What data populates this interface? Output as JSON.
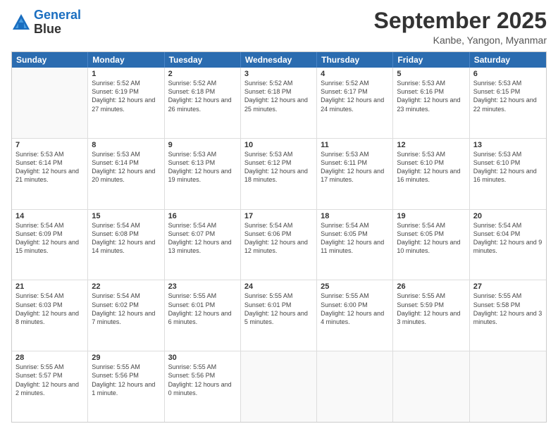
{
  "logo": {
    "line1": "General",
    "line2": "Blue"
  },
  "title": "September 2025",
  "location": "Kanbe, Yangon, Myanmar",
  "weekdays": [
    "Sunday",
    "Monday",
    "Tuesday",
    "Wednesday",
    "Thursday",
    "Friday",
    "Saturday"
  ],
  "rows": [
    [
      {
        "day": "",
        "sunrise": "",
        "sunset": "",
        "daylight": ""
      },
      {
        "day": "1",
        "sunrise": "Sunrise: 5:52 AM",
        "sunset": "Sunset: 6:19 PM",
        "daylight": "Daylight: 12 hours and 27 minutes."
      },
      {
        "day": "2",
        "sunrise": "Sunrise: 5:52 AM",
        "sunset": "Sunset: 6:18 PM",
        "daylight": "Daylight: 12 hours and 26 minutes."
      },
      {
        "day": "3",
        "sunrise": "Sunrise: 5:52 AM",
        "sunset": "Sunset: 6:18 PM",
        "daylight": "Daylight: 12 hours and 25 minutes."
      },
      {
        "day": "4",
        "sunrise": "Sunrise: 5:52 AM",
        "sunset": "Sunset: 6:17 PM",
        "daylight": "Daylight: 12 hours and 24 minutes."
      },
      {
        "day": "5",
        "sunrise": "Sunrise: 5:53 AM",
        "sunset": "Sunset: 6:16 PM",
        "daylight": "Daylight: 12 hours and 23 minutes."
      },
      {
        "day": "6",
        "sunrise": "Sunrise: 5:53 AM",
        "sunset": "Sunset: 6:15 PM",
        "daylight": "Daylight: 12 hours and 22 minutes."
      }
    ],
    [
      {
        "day": "7",
        "sunrise": "Sunrise: 5:53 AM",
        "sunset": "Sunset: 6:14 PM",
        "daylight": "Daylight: 12 hours and 21 minutes."
      },
      {
        "day": "8",
        "sunrise": "Sunrise: 5:53 AM",
        "sunset": "Sunset: 6:14 PM",
        "daylight": "Daylight: 12 hours and 20 minutes."
      },
      {
        "day": "9",
        "sunrise": "Sunrise: 5:53 AM",
        "sunset": "Sunset: 6:13 PM",
        "daylight": "Daylight: 12 hours and 19 minutes."
      },
      {
        "day": "10",
        "sunrise": "Sunrise: 5:53 AM",
        "sunset": "Sunset: 6:12 PM",
        "daylight": "Daylight: 12 hours and 18 minutes."
      },
      {
        "day": "11",
        "sunrise": "Sunrise: 5:53 AM",
        "sunset": "Sunset: 6:11 PM",
        "daylight": "Daylight: 12 hours and 17 minutes."
      },
      {
        "day": "12",
        "sunrise": "Sunrise: 5:53 AM",
        "sunset": "Sunset: 6:10 PM",
        "daylight": "Daylight: 12 hours and 16 minutes."
      },
      {
        "day": "13",
        "sunrise": "Sunrise: 5:53 AM",
        "sunset": "Sunset: 6:10 PM",
        "daylight": "Daylight: 12 hours and 16 minutes."
      }
    ],
    [
      {
        "day": "14",
        "sunrise": "Sunrise: 5:54 AM",
        "sunset": "Sunset: 6:09 PM",
        "daylight": "Daylight: 12 hours and 15 minutes."
      },
      {
        "day": "15",
        "sunrise": "Sunrise: 5:54 AM",
        "sunset": "Sunset: 6:08 PM",
        "daylight": "Daylight: 12 hours and 14 minutes."
      },
      {
        "day": "16",
        "sunrise": "Sunrise: 5:54 AM",
        "sunset": "Sunset: 6:07 PM",
        "daylight": "Daylight: 12 hours and 13 minutes."
      },
      {
        "day": "17",
        "sunrise": "Sunrise: 5:54 AM",
        "sunset": "Sunset: 6:06 PM",
        "daylight": "Daylight: 12 hours and 12 minutes."
      },
      {
        "day": "18",
        "sunrise": "Sunrise: 5:54 AM",
        "sunset": "Sunset: 6:05 PM",
        "daylight": "Daylight: 12 hours and 11 minutes."
      },
      {
        "day": "19",
        "sunrise": "Sunrise: 5:54 AM",
        "sunset": "Sunset: 6:05 PM",
        "daylight": "Daylight: 12 hours and 10 minutes."
      },
      {
        "day": "20",
        "sunrise": "Sunrise: 5:54 AM",
        "sunset": "Sunset: 6:04 PM",
        "daylight": "Daylight: 12 hours and 9 minutes."
      }
    ],
    [
      {
        "day": "21",
        "sunrise": "Sunrise: 5:54 AM",
        "sunset": "Sunset: 6:03 PM",
        "daylight": "Daylight: 12 hours and 8 minutes."
      },
      {
        "day": "22",
        "sunrise": "Sunrise: 5:54 AM",
        "sunset": "Sunset: 6:02 PM",
        "daylight": "Daylight: 12 hours and 7 minutes."
      },
      {
        "day": "23",
        "sunrise": "Sunrise: 5:55 AM",
        "sunset": "Sunset: 6:01 PM",
        "daylight": "Daylight: 12 hours and 6 minutes."
      },
      {
        "day": "24",
        "sunrise": "Sunrise: 5:55 AM",
        "sunset": "Sunset: 6:01 PM",
        "daylight": "Daylight: 12 hours and 5 minutes."
      },
      {
        "day": "25",
        "sunrise": "Sunrise: 5:55 AM",
        "sunset": "Sunset: 6:00 PM",
        "daylight": "Daylight: 12 hours and 4 minutes."
      },
      {
        "day": "26",
        "sunrise": "Sunrise: 5:55 AM",
        "sunset": "Sunset: 5:59 PM",
        "daylight": "Daylight: 12 hours and 3 minutes."
      },
      {
        "day": "27",
        "sunrise": "Sunrise: 5:55 AM",
        "sunset": "Sunset: 5:58 PM",
        "daylight": "Daylight: 12 hours and 3 minutes."
      }
    ],
    [
      {
        "day": "28",
        "sunrise": "Sunrise: 5:55 AM",
        "sunset": "Sunset: 5:57 PM",
        "daylight": "Daylight: 12 hours and 2 minutes."
      },
      {
        "day": "29",
        "sunrise": "Sunrise: 5:55 AM",
        "sunset": "Sunset: 5:56 PM",
        "daylight": "Daylight: 12 hours and 1 minute."
      },
      {
        "day": "30",
        "sunrise": "Sunrise: 5:55 AM",
        "sunset": "Sunset: 5:56 PM",
        "daylight": "Daylight: 12 hours and 0 minutes."
      },
      {
        "day": "",
        "sunrise": "",
        "sunset": "",
        "daylight": ""
      },
      {
        "day": "",
        "sunrise": "",
        "sunset": "",
        "daylight": ""
      },
      {
        "day": "",
        "sunrise": "",
        "sunset": "",
        "daylight": ""
      },
      {
        "day": "",
        "sunrise": "",
        "sunset": "",
        "daylight": ""
      }
    ]
  ]
}
